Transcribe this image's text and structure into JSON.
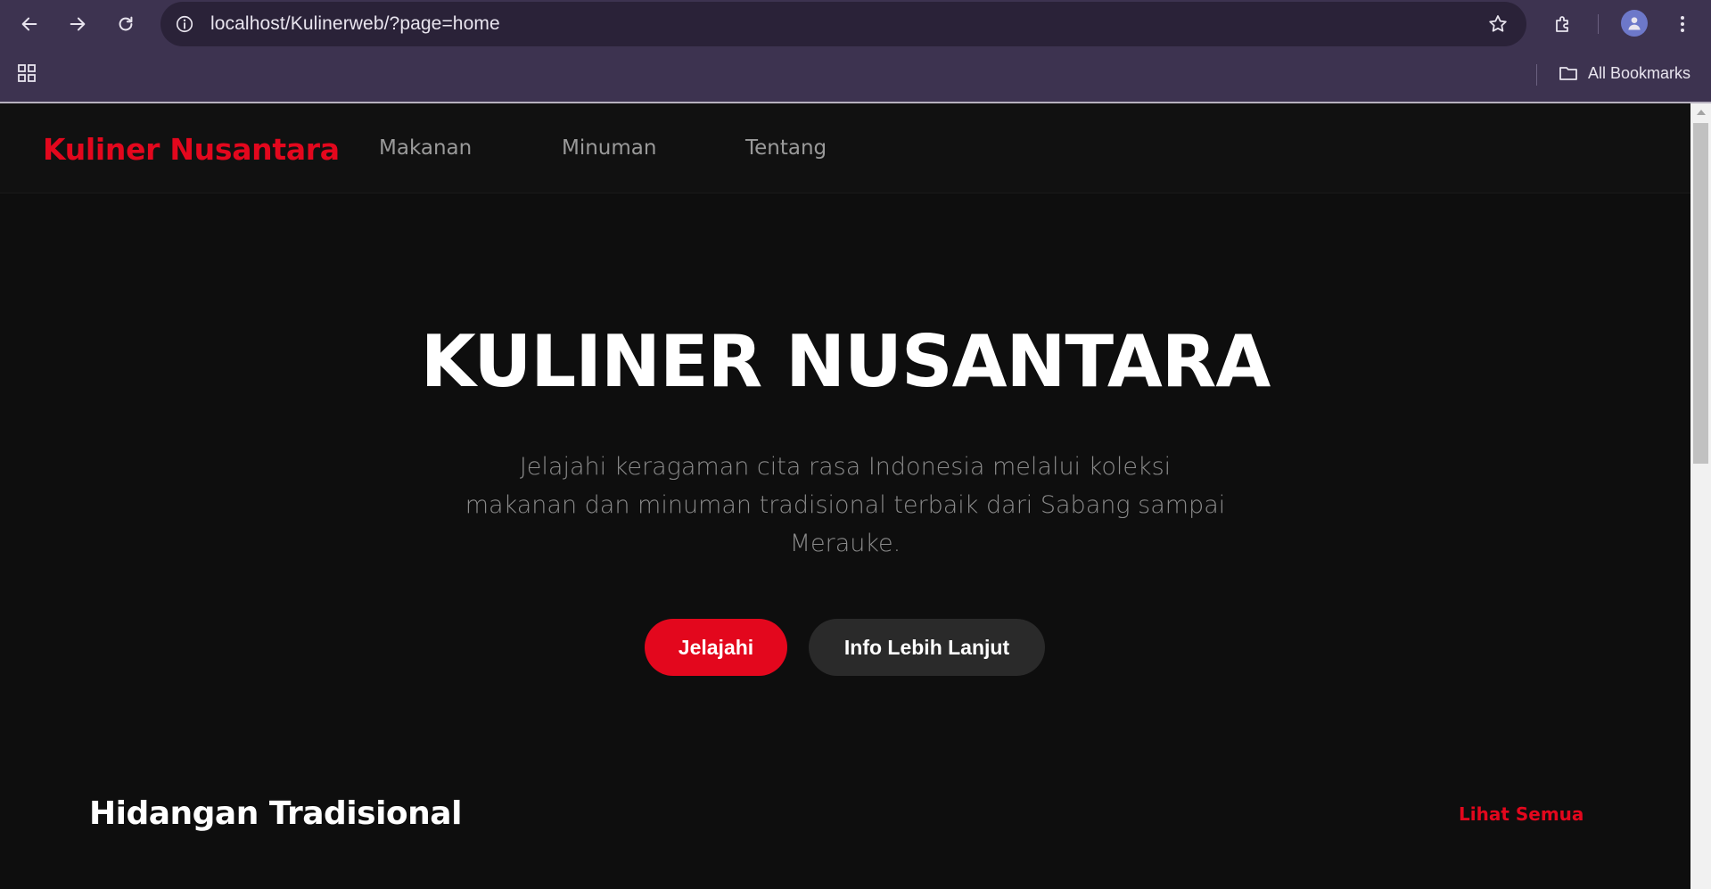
{
  "browser": {
    "url": "localhost/Kulinerweb/?page=home",
    "bookmarks_label": "All Bookmarks"
  },
  "icons": {
    "back": "arrow-left-icon",
    "forward": "arrow-right-icon",
    "reload": "reload-icon",
    "site_info": "info-icon",
    "bookmark_star": "star-icon",
    "extensions": "puzzle-icon",
    "profile": "avatar-icon",
    "menu": "kebab-menu-icon",
    "apps": "grid-icon",
    "bookmarks_folder": "folder-icon"
  },
  "site": {
    "logo": "Kuliner Nusantara",
    "nav": [
      "Makanan",
      "Minuman",
      "Tentang"
    ]
  },
  "hero": {
    "title": "KULINER NUSANTARA",
    "subtitle": "Jelajahi keragaman cita rasa Indonesia melalui koleksi makanan dan minuman tradisional terbaik dari Sabang sampai Merauke.",
    "primary_button": "Jelajahi",
    "secondary_button": "Info Lebih Lanjut"
  },
  "section": {
    "title": "Hidangan Tradisional",
    "see_all": "Lihat Semua"
  },
  "colors": {
    "accent": "#e3071d",
    "page_bg": "#0e0e0e",
    "nav_bg": "#111111",
    "chrome_bg": "#3d3350"
  }
}
